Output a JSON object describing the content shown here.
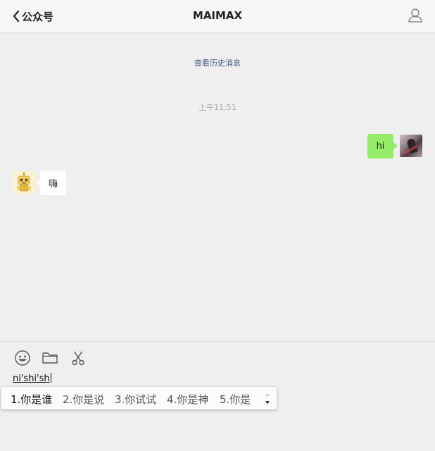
{
  "header": {
    "back_label": "公众号",
    "title": "MAIMAX"
  },
  "chat": {
    "history_link": "查看历史消息",
    "timestamp": "上午11:51",
    "messages": [
      {
        "direction": "outgoing",
        "text": "hi"
      },
      {
        "direction": "incoming",
        "text": "嗨"
      }
    ]
  },
  "composer": {
    "toolbar": [
      "emoji-icon",
      "folder-icon",
      "scissors-icon"
    ],
    "text": "ni'shi'sh"
  },
  "ime": {
    "candidates": [
      {
        "label": "1.你是谁",
        "selected": true
      },
      {
        "label": "2.你是说",
        "selected": false
      },
      {
        "label": "3.你试试",
        "selected": false
      },
      {
        "label": "4.你是神",
        "selected": false
      },
      {
        "label": "5.你是",
        "selected": false
      }
    ]
  },
  "colors": {
    "outgoing_bubble": "#95ec69",
    "incoming_bubble": "#ffffff",
    "chat_background": "#efefef",
    "link": "#4a5a86"
  }
}
